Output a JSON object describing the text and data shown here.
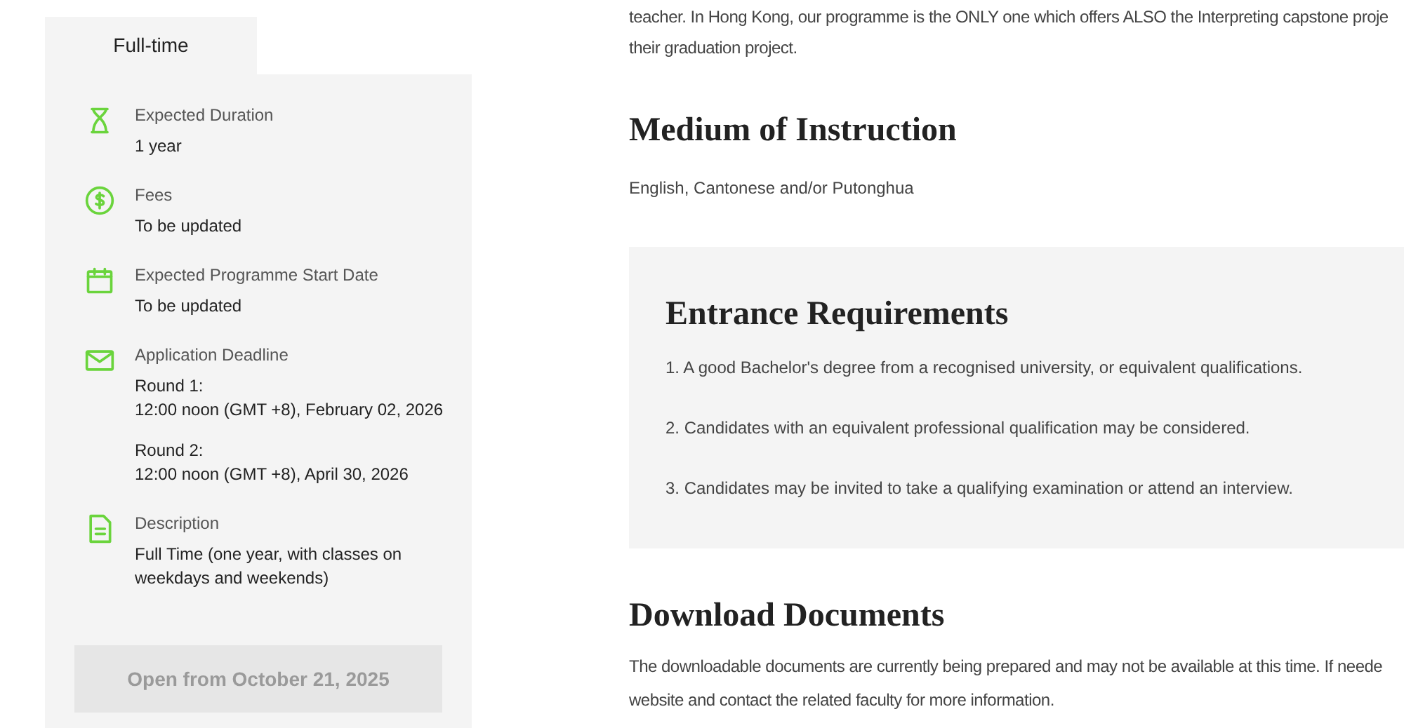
{
  "sidebar": {
    "tabs": [
      {
        "label": "Full-time",
        "selected": true
      }
    ],
    "items": [
      {
        "kind": "hourglass",
        "label": "Expected Duration",
        "values": [
          "1 year"
        ]
      },
      {
        "kind": "dollar",
        "label": "Fees",
        "values": [
          "To be updated"
        ]
      },
      {
        "kind": "calendar",
        "label": "Expected Programme Start Date",
        "values": [
          "To be updated"
        ]
      },
      {
        "kind": "mail",
        "label": "Application Deadline",
        "values": [
          "Round 1:\n12:00 noon (GMT +8), February 02, 2026",
          "Round 2:\n12:00 noon (GMT +8), April 30, 2026"
        ]
      },
      {
        "kind": "document",
        "label": "Description",
        "values": [
          "Full Time (one year, with classes on weekdays and weekends)"
        ]
      }
    ],
    "button": {
      "label": "Open from October 21, 2025",
      "disabled": true
    }
  },
  "intro_lines": [
    "teacher. In Hong Kong, our programme is the ONLY one which offers ALSO the Interpreting capstone proje",
    "their graduation project."
  ],
  "medium": {
    "title": "Medium of Instruction",
    "text": "English, Cantonese and/or Putonghua"
  },
  "entrance": {
    "title": "Entrance Requirements",
    "items": [
      "1. A good Bachelor's degree from a recognised university, or equivalent qualifications.",
      "2. Candidates with an equivalent professional qualification may be considered.",
      "3. Candidates may be invited to take a qualifying examination or attend an interview."
    ]
  },
  "downloads": {
    "title": "Download Documents",
    "lines": [
      "The downloadable documents are currently being prepared and may not be available at this time. If neede",
      "website and contact the related faculty for more information."
    ]
  }
}
